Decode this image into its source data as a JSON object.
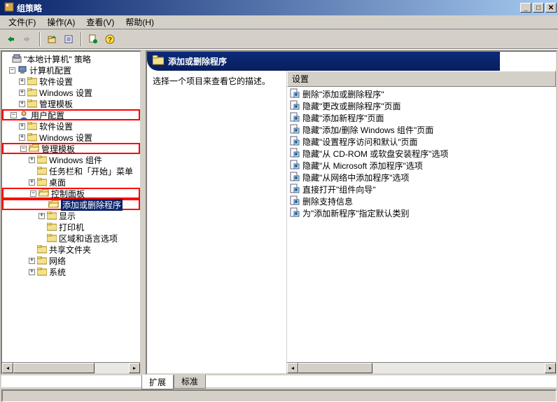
{
  "window": {
    "title": "组策略"
  },
  "menu": {
    "file": "文件(F)",
    "action": "操作(A)",
    "view": "查看(V)",
    "help": "帮助(H)"
  },
  "tree": {
    "root": "\"本地计算机\" 策略",
    "computer_config": "计算机配置",
    "cc_software": "软件设置",
    "cc_windows": "Windows 设置",
    "cc_admin": "管理模板",
    "user_config": "用户配置",
    "uc_software": "软件设置",
    "uc_windows": "Windows 设置",
    "uc_admin": "管理模板",
    "win_components": "Windows 组件",
    "taskbar": "任务栏和「开始」菜单",
    "desktop": "桌面",
    "control_panel": "控制面板",
    "add_remove": "添加或删除程序",
    "display": "显示",
    "printers": "打印机",
    "regional": "区域和语言选项",
    "shared": "共享文件夹",
    "network": "网络",
    "system": "系统"
  },
  "detail": {
    "header": "添加或删除程序",
    "desc_prompt": "选择一个项目来查看它的描述。",
    "col_header": "设置",
    "items": [
      "删除\"添加或删除程序\"",
      "隐藏\"更改或删除程序\"页面",
      "隐藏\"添加新程序\"页面",
      "隐藏\"添加/删除 Windows 组件\"页面",
      "隐藏\"设置程序访问和默认\"页面",
      "隐藏\"从 CD-ROM 或软盘安装程序\"选项",
      "隐藏\"从 Microsoft 添加程序\"选项",
      "隐藏\"从网络中添加程序\"选项",
      "直接打开\"组件向导\"",
      "删除支持信息",
      "为\"添加新程序\"指定默认类别"
    ]
  },
  "tabs": {
    "extended": "扩展",
    "standard": "标准"
  }
}
